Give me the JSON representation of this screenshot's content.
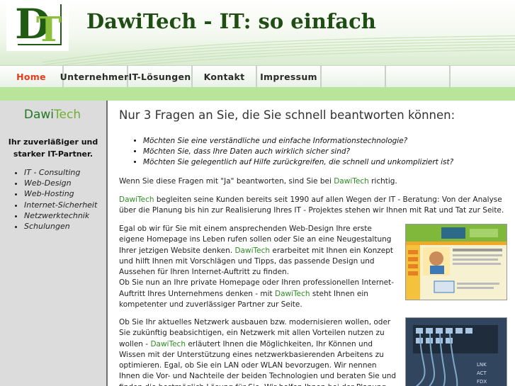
{
  "header": {
    "logo_letter_1": "D",
    "logo_letter_2": "T",
    "site_title": "DawiTech - IT: so einfach"
  },
  "nav": {
    "items": [
      "Home",
      "Unternehmen",
      "IT-Lösungen",
      "Kontakt",
      "Impressum",
      "",
      "",
      ""
    ],
    "active": "Home"
  },
  "sidebar": {
    "brand_1": "Dawi",
    "brand_2": "Tech",
    "tagline": "Ihr zuverläßiger und starker IT-Partner.",
    "items": [
      "IT - Consulting",
      "Web-Design",
      "Web-Hosting",
      "Internet-Sicherheit",
      "Netzwerktechnik",
      "Schulungen"
    ]
  },
  "main": {
    "headline": "Nur 3 Fragen an Sie, die Sie schnell beantworten können:",
    "questions": [
      "Möchten Sie eine verständliche und einfache Informationstechnologie?",
      "Möchten Sie, dass Ihre Daten auch wirklich sicher sind?",
      "Möchten Sie gelegentlich auf Hilfe zurückgreifen, die schnell und unkompliziert ist?"
    ],
    "p1_a": "Wenn Sie diese Fragen mit \"Ja\" beantworten, sind Sie bei ",
    "p1_brand": "DawiTech",
    "p1_b": " richtig.",
    "p2_brand": "DawiTech",
    "p2_rest": " begleiten seine Kunden bereits seit 1990 auf allen Wegen der IT - Beratung: Von der Analyse über die Planung bis hin zur Realisierung Ihres IT - Projektes stehen wir Ihnen mit Rat und Tat zur Seite.",
    "p3_a": "Egal ob wir für Sie mit einem ansprechenden Web-Design Ihre erste eigene Homepage ins Leben rufen sollen oder Sie an eine Neugestaltung Ihrer jetzigen Website denken. ",
    "p3_brand": "DawiTech",
    "p3_b": " erarbeitet mit Ihnen ein Konzept und hilft Ihnen mit Vorschlägen und Tipps, das passende Design und Aussehen für Ihren Internet-Auftritt zu finden.",
    "p3_c": "Ob Sie nun an Ihre private Homepage oder Ihren professionellen Internet-Auftritt Ihres Unternehmens denken - mit ",
    "p3_brand2": "DawiTech",
    "p3_d": " steht Ihnen ein kompetenter und zuverlässiger Partner zur Seite.",
    "p4_a": "Ob Sie Ihr aktuelles Netzwerk ausbauen bzw. modernisieren wollen, oder Sie zukünftig beabsichtigen, ein Netzwerk mit allen Vorteilen nutzen zu wollen - ",
    "p4_brand": "DawiTech",
    "p4_b": " erläutert Ihnen die Möglichkeiten, Ihr Können und Wissen mit der Unterstützung eines netzwerkbasierenden Arbeitens zu optimieren. Egal, ob Sie ein LAN oder WLAN bevorzugen. Wir nennen Ihnen die Vor- und Nachteile der beiden Technologien und beraten Sie und finden die bestmöglich Lösung für Sie. Wir helfen Ihnen bei der Planung oder Realisierung Ihrer Wünsche - vertrauen Sie"
  },
  "colors": {
    "brand_dark": "#1f5b12",
    "brand_light": "#8cbf3a",
    "nav_active": "#e63b1b",
    "green_band": "#b9e59a",
    "sidebar_bg": "#dcdcdc"
  }
}
